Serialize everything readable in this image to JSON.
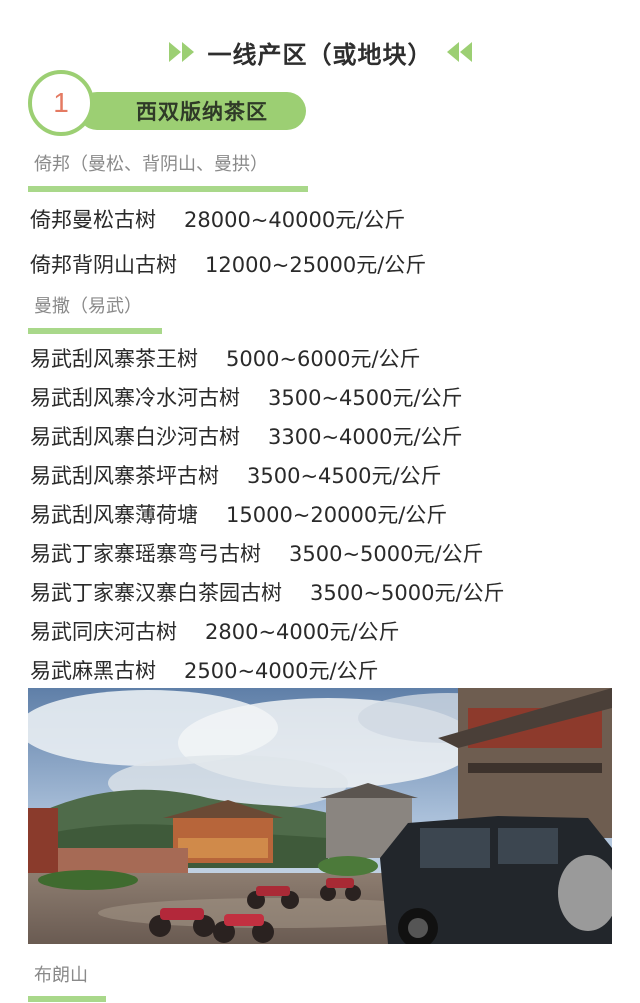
{
  "title": "一线产区（或地块）",
  "region": {
    "number": "1",
    "label": "西双版纳茶区"
  },
  "sections": [
    {
      "heading": "倚邦（曼松、背阴山、曼拱）",
      "items": [
        {
          "name": "倚邦曼松古树",
          "price": "28000~40000元/公斤"
        },
        {
          "name": "倚邦背阴山古树",
          "price": "12000~25000元/公斤"
        }
      ]
    },
    {
      "heading": "曼撒（易武）",
      "items": [
        {
          "name": "易武刮风寨茶王树",
          "price": "5000~6000元/公斤"
        },
        {
          "name": "易武刮风寨冷水河古树",
          "price": "3500~4500元/公斤"
        },
        {
          "name": "易武刮风寨白沙河古树",
          "price": "3300~4000元/公斤"
        },
        {
          "name": "易武刮风寨茶坪古树",
          "price": "3500~4500元/公斤"
        },
        {
          "name": "易武刮风寨薄荷塘",
          "price": "15000~20000元/公斤"
        },
        {
          "name": "易武丁家寨瑶寨弯弓古树",
          "price": "3500~5000元/公斤"
        },
        {
          "name": "易武丁家寨汉寨白茶园古树",
          "price": "3500~5000元/公斤"
        },
        {
          "name": "易武同庆河古树",
          "price": "2800~4000元/公斤"
        },
        {
          "name": "易武麻黑古树",
          "price": "2500~4000元/公斤"
        }
      ]
    },
    {
      "heading": "布朗山"
    }
  ],
  "colors": {
    "accent_green": "#9ccf73",
    "number_red": "#e47a62",
    "heading_gray": "#8a8a8a"
  },
  "icons": {
    "left_arrows": "double-chevron-right-icon",
    "right_arrows": "double-chevron-left-icon"
  }
}
